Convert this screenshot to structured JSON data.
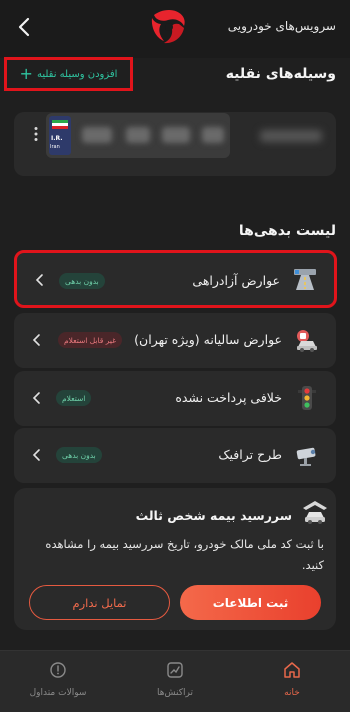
{
  "header": {
    "title": "سرویس‌های خودرویی",
    "back_icon": "chevron-left-icon",
    "logo_icon": "brand-logo-icon"
  },
  "vehicles": {
    "section_title": "وسیله‌های نقلیه",
    "add_label": "افزودن وسیله نقلیه",
    "plate": {
      "flag_text": "I.R.",
      "country_text": "Iran"
    }
  },
  "debts": {
    "section_title": "لیست بدهی‌ها",
    "items": [
      {
        "label": "عوارض آزادراهی",
        "badge": "بدون بدهی",
        "status": "ok",
        "icon": "freeway-icon"
      },
      {
        "label": "عوارض سالیانه (ویژه تهران)",
        "badge": "غیر قابل استعلام",
        "status": "bad",
        "icon": "car-annual-icon"
      },
      {
        "label": "خلافی پرداخت نشده",
        "badge": "استعلام",
        "status": "ok",
        "icon": "traffic-light-icon"
      },
      {
        "label": "طرح ترافیک",
        "badge": "بدون بدهی",
        "status": "ok",
        "icon": "traffic-camera-icon"
      }
    ]
  },
  "insurance": {
    "title": "سررسید بیمه شخص ثالث",
    "description": "با ثبت کد ملی مالک خودرو، تاریخ سررسید بیمه را مشاهده کنید.",
    "submit_label": "ثبت اطلاعات",
    "decline_label": "تمایل ندارم"
  },
  "nav": {
    "items": [
      {
        "label": "خانه",
        "icon": "home-icon",
        "active": true
      },
      {
        "label": "تراکنش‌ها",
        "icon": "transactions-icon",
        "active": false
      },
      {
        "label": "سوالات متداول",
        "icon": "faq-icon",
        "active": false
      }
    ]
  },
  "colors": {
    "accent": "#e9402d",
    "highlight": "#e0141b",
    "ok_badge": "#6fd0a9",
    "bad_badge": "#ea7a7f",
    "background": "#1b1b1b",
    "card": "#2a2a2a"
  }
}
